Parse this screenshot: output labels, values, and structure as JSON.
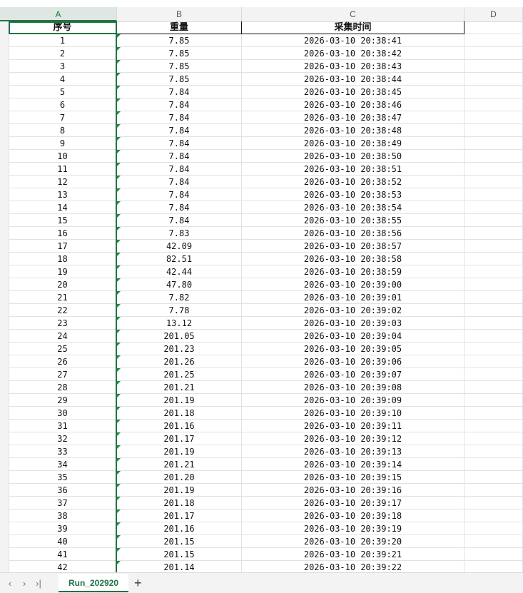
{
  "columns": [
    "A",
    "B",
    "C",
    "D"
  ],
  "headers": {
    "seq": "序号",
    "weight": "重量",
    "time": "采集时间"
  },
  "rows": [
    [
      "1",
      "7.85",
      "2026-03-10 20:38:41"
    ],
    [
      "2",
      "7.85",
      "2026-03-10 20:38:42"
    ],
    [
      "3",
      "7.85",
      "2026-03-10 20:38:43"
    ],
    [
      "4",
      "7.85",
      "2026-03-10 20:38:44"
    ],
    [
      "5",
      "7.84",
      "2026-03-10 20:38:45"
    ],
    [
      "6",
      "7.84",
      "2026-03-10 20:38:46"
    ],
    [
      "7",
      "7.84",
      "2026-03-10 20:38:47"
    ],
    [
      "8",
      "7.84",
      "2026-03-10 20:38:48"
    ],
    [
      "9",
      "7.84",
      "2026-03-10 20:38:49"
    ],
    [
      "10",
      "7.84",
      "2026-03-10 20:38:50"
    ],
    [
      "11",
      "7.84",
      "2026-03-10 20:38:51"
    ],
    [
      "12",
      "7.84",
      "2026-03-10 20:38:52"
    ],
    [
      "13",
      "7.84",
      "2026-03-10 20:38:53"
    ],
    [
      "14",
      "7.84",
      "2026-03-10 20:38:54"
    ],
    [
      "15",
      "7.84",
      "2026-03-10 20:38:55"
    ],
    [
      "16",
      "7.83",
      "2026-03-10 20:38:56"
    ],
    [
      "17",
      "42.09",
      "2026-03-10 20:38:57"
    ],
    [
      "18",
      "82.51",
      "2026-03-10 20:38:58"
    ],
    [
      "19",
      "42.44",
      "2026-03-10 20:38:59"
    ],
    [
      "20",
      "47.80",
      "2026-03-10 20:39:00"
    ],
    [
      "21",
      "7.82",
      "2026-03-10 20:39:01"
    ],
    [
      "22",
      "7.78",
      "2026-03-10 20:39:02"
    ],
    [
      "23",
      "13.12",
      "2026-03-10 20:39:03"
    ],
    [
      "24",
      "201.05",
      "2026-03-10 20:39:04"
    ],
    [
      "25",
      "201.23",
      "2026-03-10 20:39:05"
    ],
    [
      "26",
      "201.26",
      "2026-03-10 20:39:06"
    ],
    [
      "27",
      "201.25",
      "2026-03-10 20:39:07"
    ],
    [
      "28",
      "201.21",
      "2026-03-10 20:39:08"
    ],
    [
      "29",
      "201.19",
      "2026-03-10 20:39:09"
    ],
    [
      "30",
      "201.18",
      "2026-03-10 20:39:10"
    ],
    [
      "31",
      "201.16",
      "2026-03-10 20:39:11"
    ],
    [
      "32",
      "201.17",
      "2026-03-10 20:39:12"
    ],
    [
      "33",
      "201.19",
      "2026-03-10 20:39:13"
    ],
    [
      "34",
      "201.21",
      "2026-03-10 20:39:14"
    ],
    [
      "35",
      "201.20",
      "2026-03-10 20:39:15"
    ],
    [
      "36",
      "201.19",
      "2026-03-10 20:39:16"
    ],
    [
      "37",
      "201.18",
      "2026-03-10 20:39:17"
    ],
    [
      "38",
      "201.17",
      "2026-03-10 20:39:18"
    ],
    [
      "39",
      "201.16",
      "2026-03-10 20:39:19"
    ],
    [
      "40",
      "201.15",
      "2026-03-10 20:39:20"
    ],
    [
      "41",
      "201.15",
      "2026-03-10 20:39:21"
    ],
    [
      "42",
      "201.14",
      "2026-03-10 20:39:22"
    ]
  ],
  "sheet_tabs": {
    "active": "Run_202920",
    "add_label": "+"
  },
  "nav_icons": {
    "first": "‹",
    "next": "›",
    "last": "›|"
  },
  "colors": {
    "accent": "#217346",
    "error_triangle": "#1e8a3c"
  }
}
